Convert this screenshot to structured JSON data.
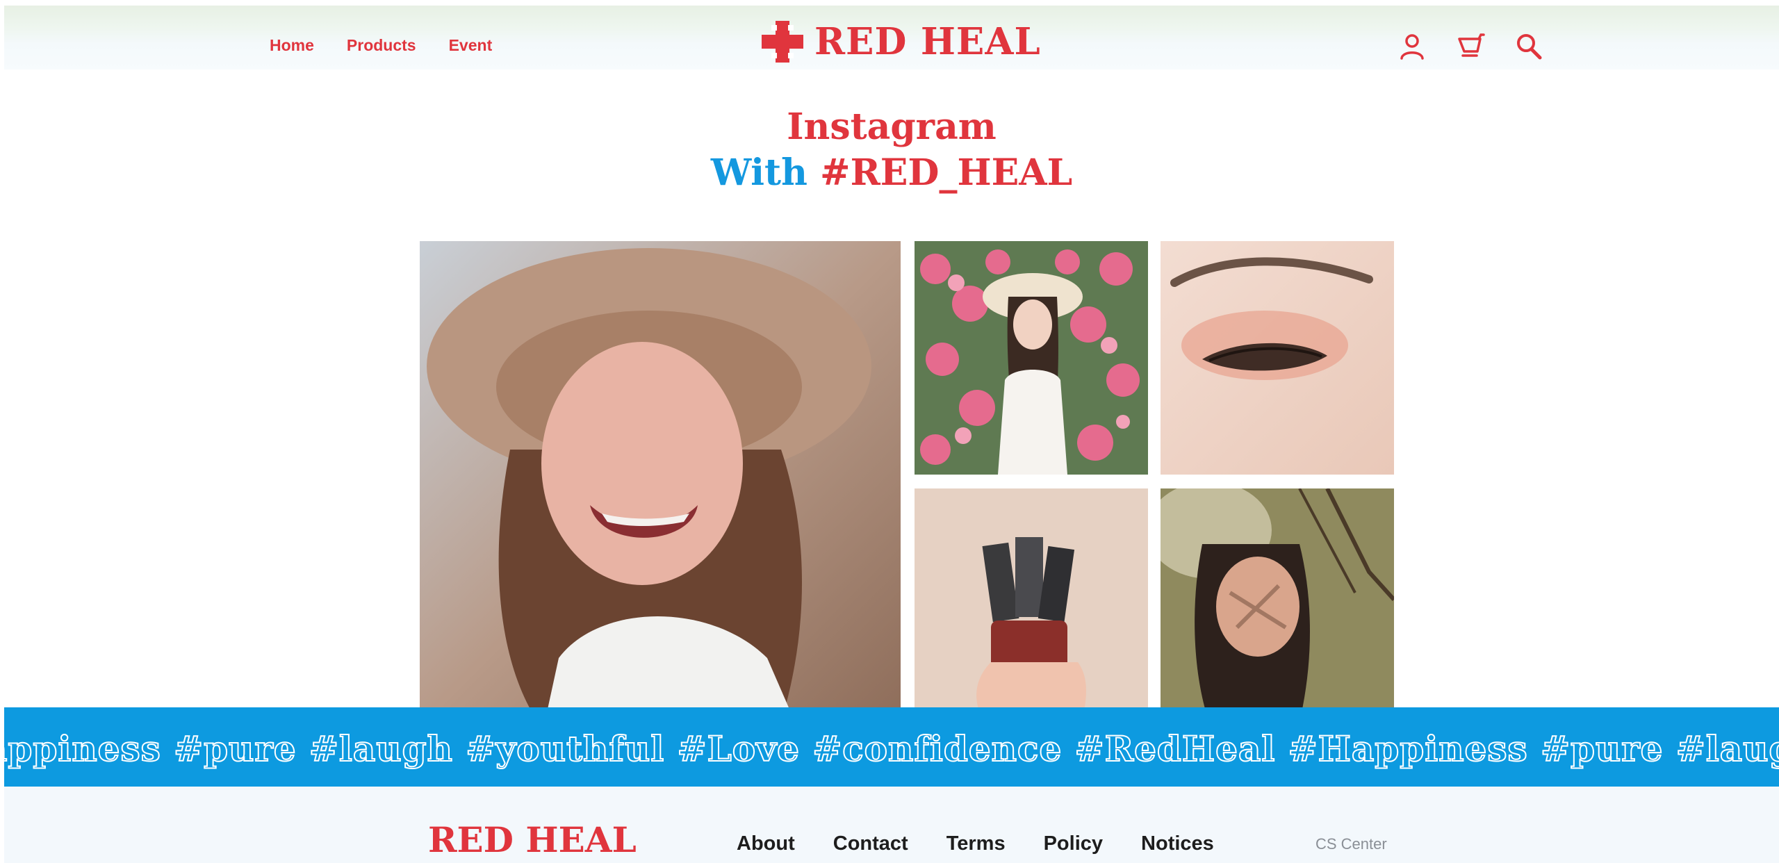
{
  "header": {
    "nav": [
      "Home",
      "Products",
      "Event"
    ],
    "logo_text": "RED HEAL",
    "icons": [
      "user-icon",
      "cart-icon",
      "search-icon"
    ]
  },
  "section": {
    "title_line1": "Instagram",
    "title_word_blue": "With",
    "title_word_red": "#RED_HEAL"
  },
  "gallery": {
    "photos": [
      "laughing-woman-hat",
      "woman-in-flowers",
      "eye-makeup-closeup",
      "lipstick-bottles-hand",
      "woman-shadow-branches"
    ]
  },
  "ticker": {
    "text": "appiness #pure #laugh #youthful #Love #confidence #RedHeal #Happiness #pure #laugh"
  },
  "footer": {
    "logo_text": "RED HEAL",
    "links": [
      "About",
      "Contact",
      "Terms",
      "Policy",
      "Notices"
    ],
    "cs_center": "CS Center"
  },
  "colors": {
    "brand_red": "#e0353d",
    "brand_blue": "#0d9ae0",
    "footer_bg": "#f3f8fc"
  }
}
